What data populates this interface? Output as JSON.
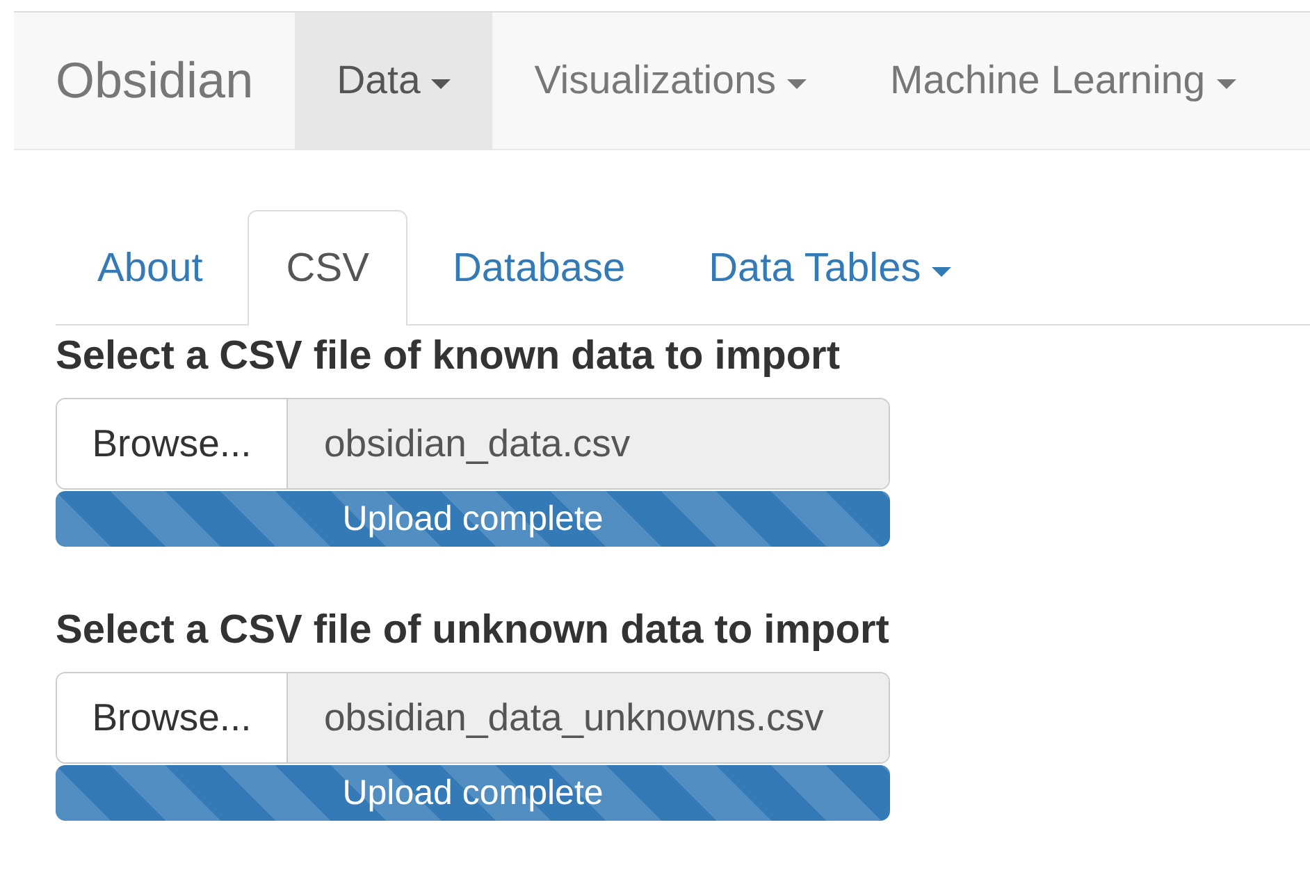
{
  "navbar": {
    "brand": "Obsidian",
    "items": [
      {
        "label": "Data",
        "dropdown": true,
        "selected": true
      },
      {
        "label": "Visualizations",
        "dropdown": true,
        "selected": false
      },
      {
        "label": "Machine Learning",
        "dropdown": true,
        "selected": false
      }
    ]
  },
  "tabs": [
    {
      "label": "About",
      "dropdown": false,
      "selected": false
    },
    {
      "label": "CSV",
      "dropdown": false,
      "selected": true
    },
    {
      "label": "Database",
      "dropdown": false,
      "selected": false
    },
    {
      "label": "Data Tables",
      "dropdown": true,
      "selected": false
    }
  ],
  "uploads": [
    {
      "label": "Select a CSV file of known data to import",
      "button": "Browse...",
      "value": "obsidian_data.csv",
      "progress": {
        "level": 1,
        "text": "Upload complete"
      }
    },
    {
      "label": "Select a CSV file of unknown data to import",
      "button": "Browse...",
      "value": "obsidian_data_unknowns.csv",
      "progress": {
        "level": 1,
        "text": "Upload complete"
      }
    }
  ]
}
